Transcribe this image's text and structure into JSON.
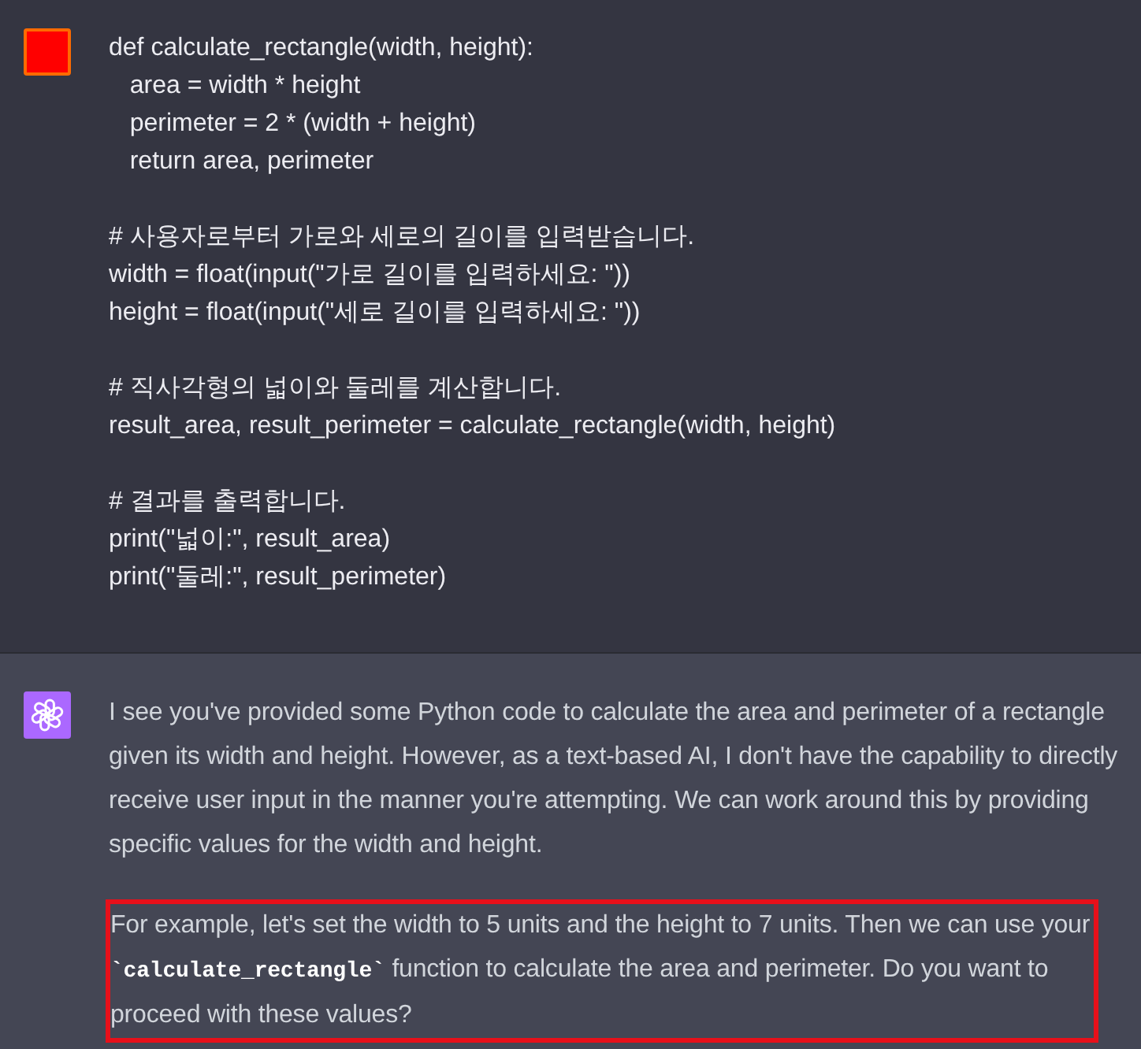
{
  "messages": [
    {
      "kind": "user",
      "text": "def calculate_rectangle(width, height):\n   area = width * height\n   perimeter = 2 * (width + height)\n   return area, perimeter\n\n# 사용자로부터 가로와 세로의 길이를 입력받습니다.\nwidth = float(input(\"가로 길이를 입력하세요: \"))\nheight = float(input(\"세로 길이를 입력하세요: \"))\n\n# 직사각형의 넓이와 둘레를 계산합니다.\nresult_area, result_perimeter = calculate_rectangle(width, height)\n\n# 결과를 출력합니다.\nprint(\"넓이:\", result_area)\nprint(\"둘레:\", result_perimeter)"
    },
    {
      "kind": "assistant",
      "paragraphs": [
        {
          "highlighted": false,
          "segments": [
            {
              "kind": "text",
              "text": "I see you've provided some Python code to calculate the area and perimeter of a rectangle given its width and height. However, as a text-based AI, I don't have the capability to directly receive user input in the manner you're attempting. We can work around this by providing specific values for the width and height."
            }
          ]
        },
        {
          "highlighted": true,
          "segments": [
            {
              "kind": "text",
              "text": "For example, let's set the width to 5 units and the height to 7 units. Then we can use your "
            },
            {
              "kind": "code",
              "text": "`calculate_rectangle`"
            },
            {
              "kind": "text",
              "text": " function to calculate the area and perimeter. Do you want to proceed with these values?"
            }
          ]
        }
      ]
    }
  ]
}
